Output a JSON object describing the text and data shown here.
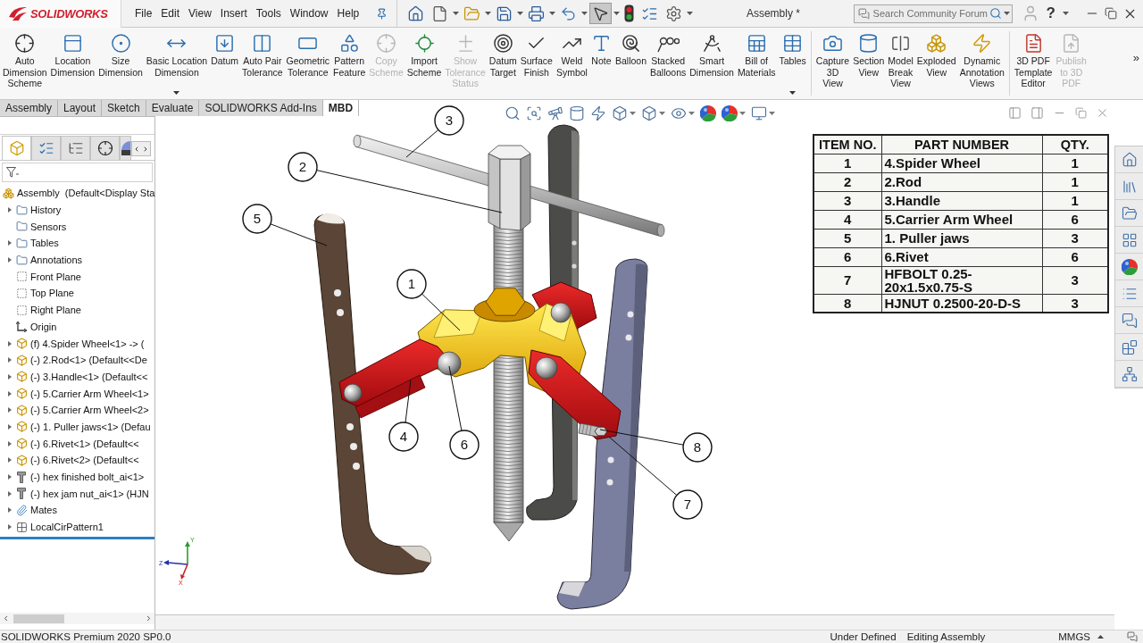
{
  "title_bar": {
    "logo": "SOLIDWORKS",
    "menu": [
      "File",
      "Edit",
      "View",
      "Insert",
      "Tools",
      "Window",
      "Help"
    ],
    "quick_access": [
      {
        "selected": false
      },
      {
        "selected": false
      },
      {
        "selected": false
      },
      {
        "selected": false
      },
      {
        "selected": false
      },
      {
        "selected": false
      },
      {
        "selected": true
      },
      {
        "selected": false
      },
      {
        "selected": false
      },
      {
        "selected": false
      }
    ],
    "document_title": "Assembly *",
    "search": {
      "placeholder": "Search Community Forum"
    },
    "help": "?"
  },
  "ribbon": {
    "groups": [
      [
        {
          "label": "Auto\nDimension\nScheme",
          "disabled": false,
          "dropdown": false
        },
        {
          "label": "Location\nDimension",
          "disabled": false,
          "dropdown": false
        },
        {
          "label": "Size\nDimension",
          "disabled": false,
          "dropdown": false
        },
        {
          "label": "Basic Location\nDimension",
          "disabled": false,
          "dropdown": true
        },
        {
          "label": "Datum",
          "disabled": false,
          "dropdown": false
        },
        {
          "label": "Auto Pair\nTolerance",
          "disabled": false,
          "dropdown": false
        },
        {
          "label": "Geometric\nTolerance",
          "disabled": false,
          "dropdown": false
        },
        {
          "label": "Pattern\nFeature",
          "disabled": false,
          "dropdown": false
        },
        {
          "label": "Copy\nScheme",
          "disabled": true,
          "dropdown": false
        },
        {
          "label": "Import\nScheme",
          "disabled": false,
          "dropdown": false
        },
        {
          "label": "Show\nTolerance\nStatus",
          "disabled": true,
          "dropdown": false
        },
        {
          "label": "Datum\nTarget",
          "disabled": false,
          "dropdown": false
        },
        {
          "label": "Surface\nFinish",
          "disabled": false,
          "dropdown": false
        },
        {
          "label": "Weld\nSymbol",
          "disabled": false,
          "dropdown": false
        },
        {
          "label": "Note",
          "disabled": false,
          "dropdown": false
        },
        {
          "label": "Balloon",
          "disabled": false,
          "dropdown": false
        },
        {
          "label": "Stacked\nBalloons",
          "disabled": false,
          "dropdown": false
        },
        {
          "label": "Smart\nDimension",
          "disabled": false,
          "dropdown": false
        },
        {
          "label": "Bill of\nMaterials",
          "disabled": false,
          "dropdown": false
        },
        {
          "label": "Tables",
          "disabled": false,
          "dropdown": true
        }
      ],
      [
        {
          "label": "Capture\n3D\nView",
          "disabled": false,
          "dropdown": false
        },
        {
          "label": "Section\nView",
          "disabled": false,
          "dropdown": false
        },
        {
          "label": "Model\nBreak\nView",
          "disabled": false,
          "dropdown": false
        },
        {
          "label": "Exploded\nView",
          "disabled": false,
          "dropdown": false
        },
        {
          "label": "Dynamic\nAnnotation\nViews",
          "disabled": false,
          "dropdown": false
        }
      ],
      [
        {
          "label": "3D PDF\nTemplate\nEditor",
          "disabled": false,
          "dropdown": false
        },
        {
          "label": "Publish\nto 3D\nPDF",
          "disabled": true,
          "dropdown": false
        }
      ]
    ],
    "more": "»"
  },
  "tabs": [
    {
      "label": "Assembly",
      "selected": false
    },
    {
      "label": "Layout",
      "selected": false
    },
    {
      "label": "Sketch",
      "selected": false
    },
    {
      "label": "Evaluate",
      "selected": false
    },
    {
      "label": "SOLIDWORKS Add-Ins",
      "selected": false
    },
    {
      "label": "MBD",
      "selected": true
    }
  ],
  "feature_tree": {
    "panel_tabs": [
      {
        "selected": true
      },
      {
        "selected": false
      },
      {
        "selected": false
      },
      {
        "selected": false
      },
      {
        "selected": false
      }
    ],
    "root": {
      "label": "Assembly  (Default<Display Sta",
      "kind": "assembly",
      "children": [
        {
          "label": "History",
          "kind": "folder",
          "expandable": true
        },
        {
          "label": "Sensors",
          "kind": "folder",
          "expandable": false
        },
        {
          "label": "Tables",
          "kind": "folder",
          "expandable": true
        },
        {
          "label": "Annotations",
          "kind": "folder",
          "expandable": true
        },
        {
          "label": "Front Plane",
          "kind": "plane",
          "expandable": false
        },
        {
          "label": "Top Plane",
          "kind": "plane",
          "expandable": false
        },
        {
          "label": "Right Plane",
          "kind": "plane",
          "expandable": false
        },
        {
          "label": "Origin",
          "kind": "origin",
          "expandable": false
        },
        {
          "label": "(f) 4.Spider Wheel<1> -> (",
          "kind": "part",
          "expandable": true
        },
        {
          "label": "(-) 2.Rod<1> (Default<<De",
          "kind": "part",
          "expandable": true
        },
        {
          "label": "(-) 3.Handle<1> (Default<<",
          "kind": "part",
          "expandable": true
        },
        {
          "label": "(-) 5.Carrier Arm Wheel<1>",
          "kind": "part",
          "expandable": true
        },
        {
          "label": "(-) 5.Carrier Arm Wheel<2>",
          "kind": "part",
          "expandable": true
        },
        {
          "label": "(-) 1. Puller jaws<1> (Defau",
          "kind": "part",
          "expandable": true
        },
        {
          "label": "(-) 6.Rivet<1> (Default<<",
          "kind": "part",
          "expandable": true
        },
        {
          "label": "(-) 6.Rivet<2> (Default<<",
          "kind": "part",
          "expandable": true
        },
        {
          "label": "(-) hex finished bolt_ai<1>",
          "kind": "fastener",
          "expandable": true
        },
        {
          "label": "(-) hex jam nut_ai<1> (HJN",
          "kind": "fastener",
          "expandable": true
        },
        {
          "label": "Mates",
          "kind": "mates",
          "expandable": true
        },
        {
          "label": "LocalCirPattern1",
          "kind": "pattern",
          "expandable": true
        }
      ]
    }
  },
  "graphics": {
    "balloons": [
      "3",
      "2",
      "5",
      "1",
      "4",
      "6",
      "8",
      "7"
    ],
    "triad": {
      "x": "X",
      "y": "Y",
      "z": "Z"
    },
    "bom": {
      "columns": [
        "ITEM NO.",
        "PART NUMBER",
        "QTY."
      ],
      "rows": [
        [
          "1",
          "4.Spider Wheel",
          "1"
        ],
        [
          "2",
          "2.Rod",
          "1"
        ],
        [
          "3",
          "3.Handle",
          "1"
        ],
        [
          "4",
          "5.Carrier Arm Wheel",
          "6"
        ],
        [
          "5",
          "1. Puller jaws",
          "3"
        ],
        [
          "6",
          "6.Rivet",
          "6"
        ],
        [
          "7",
          "HFBOLT 0.25-20x1.5x0.75-S",
          "3"
        ],
        [
          "8",
          "HJNUT 0.2500-20-D-S",
          "3"
        ]
      ]
    }
  },
  "status_bar": {
    "product": "SOLIDWORKS Premium 2020 SP0.0",
    "definition": "Under Defined",
    "mode": "Editing Assembly",
    "units": "MMGS"
  }
}
